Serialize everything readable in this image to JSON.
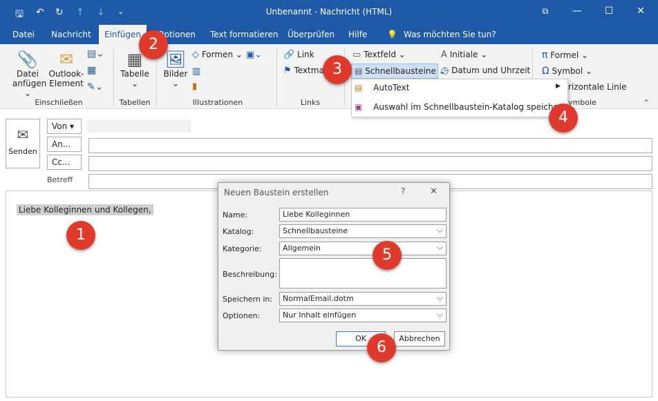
{
  "window": {
    "title": "Unbenannt  -  Nachricht (HTML)",
    "minimize": "—",
    "maximize": "☐",
    "close": "✕"
  },
  "tabs": [
    "Datei",
    "Nachricht",
    "Einfügen",
    "Optionen",
    "Text formatieren",
    "Überprüfen",
    "Hilfe",
    "Was möchten Sie tun?"
  ],
  "ribbon": {
    "datei_anfuegen": [
      "Datei",
      "anfügen ⌄"
    ],
    "outlook_element": [
      "Outlook-",
      "Element"
    ],
    "tabelle": [
      "Tabelle",
      "⌄"
    ],
    "bilder": [
      "Bilder",
      "⌄"
    ],
    "formen": "Formen ⌄",
    "link": "Link",
    "textmarke": "Textma",
    "textfeld": "Textfeld ⌄",
    "schnellbausteine": "Schnellbausteine ⌄",
    "initiale": "Initiale ⌄",
    "datum_uhrzeit": "Datum und Uhrzeit",
    "formel": "Formel ⌄",
    "symbol": "Symbol ⌄",
    "horizontale_linie": "rizontale Linie",
    "groups": [
      "Einschließen",
      "Tabellen",
      "Illustrationen",
      "Links",
      "ymbole"
    ]
  },
  "dropdown": {
    "item1": "AutoText",
    "item2": "Auswahl im Schnellbaustein-Katalog speichern..."
  },
  "mail": {
    "send": "Senden",
    "von": "Von ▾",
    "an": "An...",
    "cc": "Cc...",
    "betreff": "Betreff",
    "body": "Liebe Kolleginnen und Kollegen,"
  },
  "dialog": {
    "title": "Neuen Baustein erstellen",
    "help": "?",
    "close": "✕",
    "fields": [
      {
        "label": "Name:",
        "value": "Liebe Kolleginnen"
      },
      {
        "label": "Katalog:",
        "value": "Schnellbausteine"
      },
      {
        "label": "Kategorie:",
        "value": "Allgemein"
      },
      {
        "label": "Beschreibung:",
        "value": ""
      },
      {
        "label": "Speichern in:",
        "value": "NormalEmail.dotm"
      },
      {
        "label": "Optionen:",
        "value": "Nur Inhalt einfügen"
      }
    ],
    "ok": "OK",
    "cancel": "Abbrechen"
  },
  "badges": [
    "1",
    "2",
    "3",
    "4",
    "5",
    "6"
  ],
  "colors": {
    "accent": "#1e5aa8",
    "badge": "#e03a2c"
  }
}
